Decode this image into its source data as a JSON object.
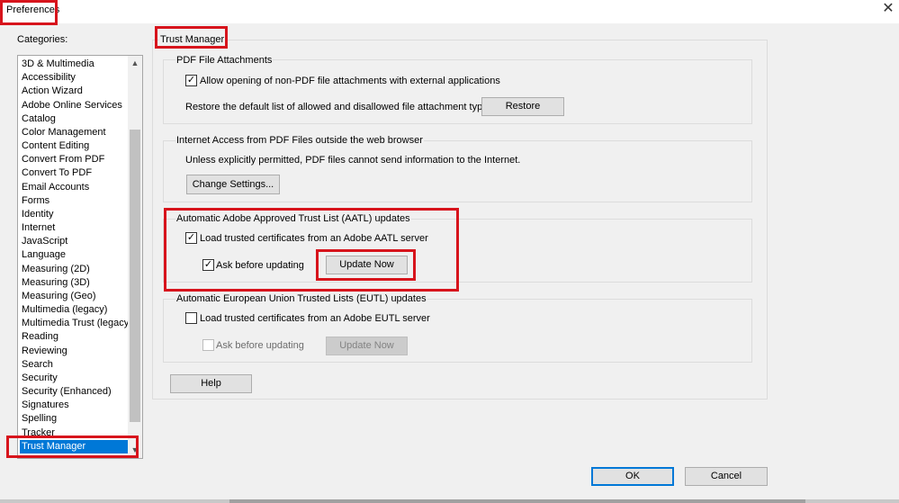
{
  "window": {
    "title": "Preferences",
    "close_icon_glyph": "✕"
  },
  "categories": {
    "label": "Categories:",
    "items": [
      "3D & Multimedia",
      "Accessibility",
      "Action Wizard",
      "Adobe Online Services",
      "Catalog",
      "Color Management",
      "Content Editing",
      "Convert From PDF",
      "Convert To PDF",
      "Email Accounts",
      "Forms",
      "Identity",
      "Internet",
      "JavaScript",
      "Language",
      "Measuring (2D)",
      "Measuring (3D)",
      "Measuring (Geo)",
      "Multimedia (legacy)",
      "Multimedia Trust (legacy)",
      "Reading",
      "Reviewing",
      "Search",
      "Security",
      "Security (Enhanced)",
      "Signatures",
      "Spelling",
      "Tracker",
      "Trust Manager"
    ],
    "selected": "Trust Manager",
    "scroll_up_glyph": "▲",
    "scroll_down_glyph": "▼"
  },
  "panel": {
    "title": "Trust Manager",
    "pdf_attachments": {
      "title": "PDF File Attachments",
      "allow_label": "Allow opening of non-PDF file attachments with external applications",
      "allow_checked": true,
      "restore_text": "Restore the default list of allowed and disallowed file attachment types:",
      "restore_button": "Restore"
    },
    "internet_access": {
      "title": "Internet Access from PDF Files outside the web browser",
      "info_text": "Unless explicitly permitted, PDF files cannot send information to the Internet.",
      "change_button": "Change Settings..."
    },
    "aatl": {
      "title": "Automatic Adobe Approved Trust List (AATL) updates",
      "load_label": "Load trusted certificates from an Adobe AATL server",
      "load_checked": true,
      "ask_label": "Ask before updating",
      "ask_checked": true,
      "update_button": "Update Now"
    },
    "eutl": {
      "title": "Automatic European Union Trusted Lists (EUTL) updates",
      "load_label": "Load trusted certificates from an Adobe EUTL server",
      "load_checked": false,
      "ask_label": "Ask before updating",
      "ask_checked": false,
      "update_button": "Update Now"
    },
    "help_button": "Help"
  },
  "footer": {
    "ok_button": "OK",
    "cancel_button": "Cancel"
  },
  "colors": {
    "highlight_red": "#d7141c",
    "selection_blue": "#0078d7"
  },
  "icons": {
    "checkmark": "✓"
  }
}
